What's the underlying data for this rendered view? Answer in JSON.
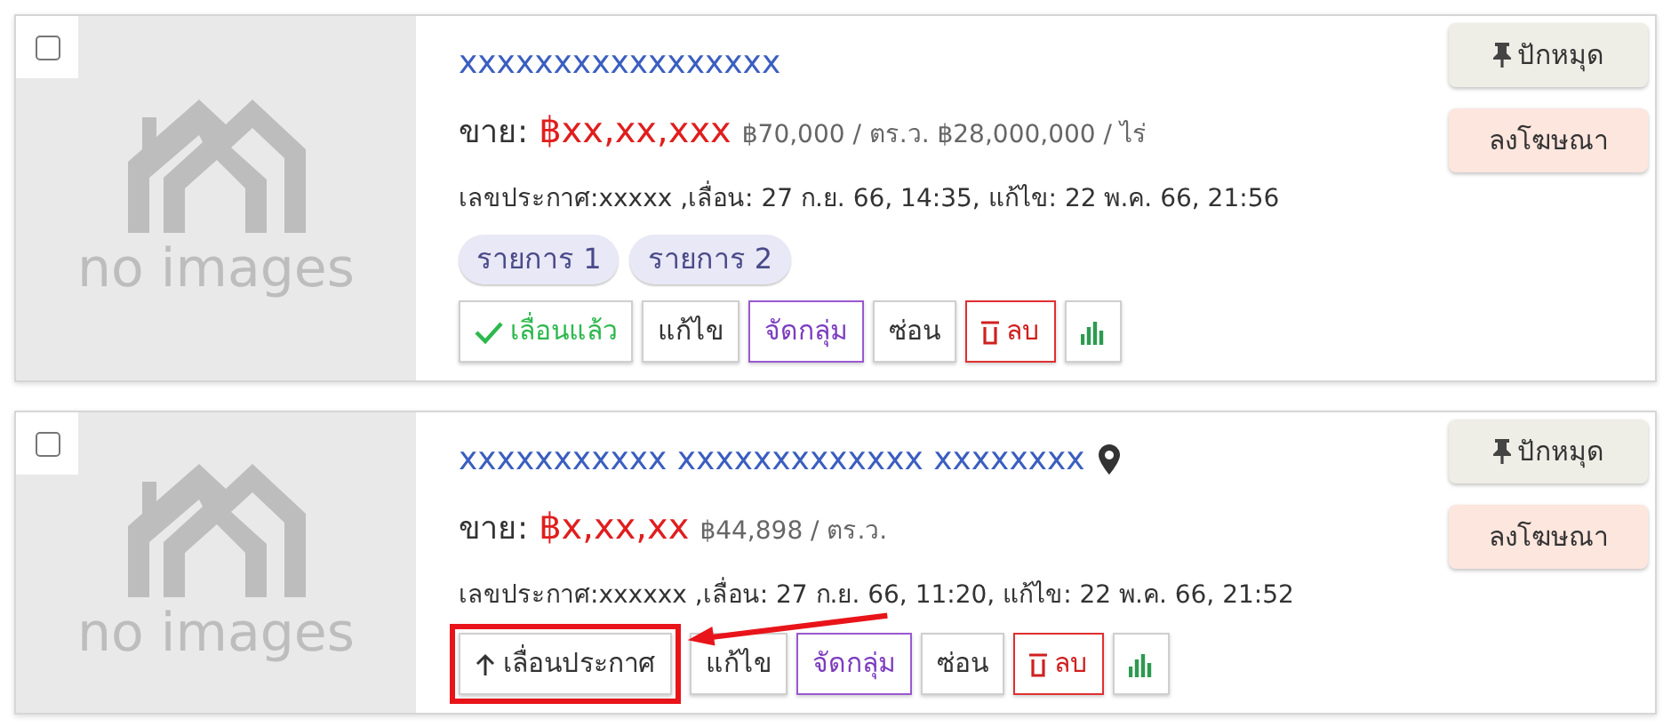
{
  "listings": [
    {
      "checked": false,
      "image": {
        "text": "no images"
      },
      "title": "xxxxxxxxxxxxxxxxx",
      "has_location": false,
      "price_label": "ขาย:",
      "price": "฿xx,xx,xxx",
      "unit_prices": "฿70,000 / ตร.ว. ฿28,000,000 / ไร่",
      "info": "เลขประกาศ:xxxxx ,เลื่อน: 27 ก.ย. 66, 14:35, แก้ไข: 22 พ.ค. 66, 21:56",
      "tags": [
        "รายการ 1",
        "รายการ 2"
      ],
      "actions": [
        {
          "kind": "promoted",
          "label": "เลื่อนแล้ว",
          "highlighted": false
        },
        {
          "kind": "edit",
          "label": "แก้ไข",
          "highlighted": false
        },
        {
          "kind": "group",
          "label": "จัดกลุ่ม",
          "highlighted": false
        },
        {
          "kind": "hide",
          "label": "ซ่อน",
          "highlighted": false
        },
        {
          "kind": "delete",
          "label": "ลบ",
          "highlighted": false
        },
        {
          "kind": "stats",
          "highlighted": false
        }
      ],
      "side_buttons": [
        {
          "kind": "pin",
          "label": "ปักหมุด"
        },
        {
          "kind": "advertise",
          "label": "ลงโฆษณา"
        }
      ]
    },
    {
      "checked": false,
      "image": {
        "text": "no images"
      },
      "title": "xxxxxxxxxxx xxxxxxxxxxxxx xxxxxxxx",
      "has_location": true,
      "price_label": "ขาย:",
      "price": "฿x,xx,xx",
      "unit_prices": "฿44,898 / ตร.ว.",
      "info": "เลขประกาศ:xxxxxx ,เลื่อน: 27 ก.ย. 66, 11:20, แก้ไข: 22 พ.ค. 66, 21:52",
      "actions": [
        {
          "kind": "promote",
          "label": "เลื่อนประกาศ",
          "highlighted": true
        },
        {
          "kind": "edit",
          "label": "แก้ไข",
          "highlighted": false
        },
        {
          "kind": "group",
          "label": "จัดกลุ่ม",
          "highlighted": false
        },
        {
          "kind": "hide",
          "label": "ซ่อน",
          "highlighted": false
        },
        {
          "kind": "delete",
          "label": "ลบ",
          "highlighted": false
        },
        {
          "kind": "stats",
          "highlighted": false
        }
      ],
      "side_buttons": [
        {
          "kind": "pin",
          "label": "ปักหมุด"
        },
        {
          "kind": "advertise",
          "label": "ลงโฆษณา"
        }
      ]
    }
  ]
}
